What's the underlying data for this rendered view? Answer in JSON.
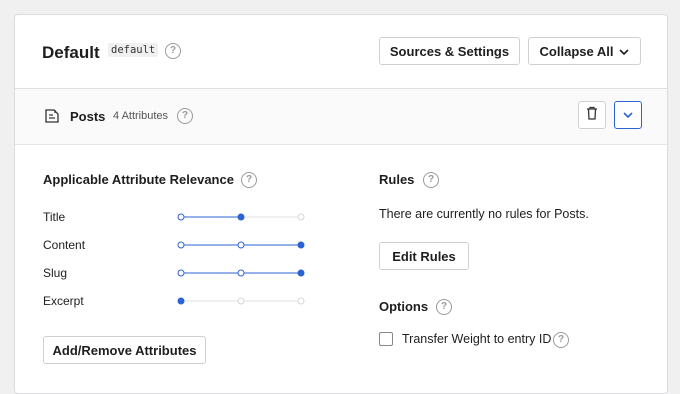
{
  "header": {
    "title": "Default",
    "slug": "default",
    "help_icon": "question-circle-icon",
    "sources_settings_label": "Sources & Settings",
    "collapse_all_label": "Collapse All"
  },
  "section": {
    "icon": "post-document-icon",
    "title": "Posts",
    "attribute_count": "4 Attributes"
  },
  "relevance": {
    "heading": "Applicable Attribute Relevance",
    "attributes": [
      {
        "label": "Title",
        "level": 0.5
      },
      {
        "label": "Content",
        "level": 1.0
      },
      {
        "label": "Slug",
        "level": 1.0
      },
      {
        "label": "Excerpt",
        "level": 0.0
      }
    ],
    "add_remove_label": "Add/Remove Attributes"
  },
  "rules": {
    "heading": "Rules",
    "empty_text": "There are currently no rules for Posts.",
    "edit_label": "Edit Rules"
  },
  "options": {
    "heading": "Options",
    "transfer_weight_label": "Transfer Weight to entry ID",
    "transfer_weight_checked": false
  },
  "colors": {
    "accent": "#2c63d4",
    "track": "#e0e0e0"
  }
}
